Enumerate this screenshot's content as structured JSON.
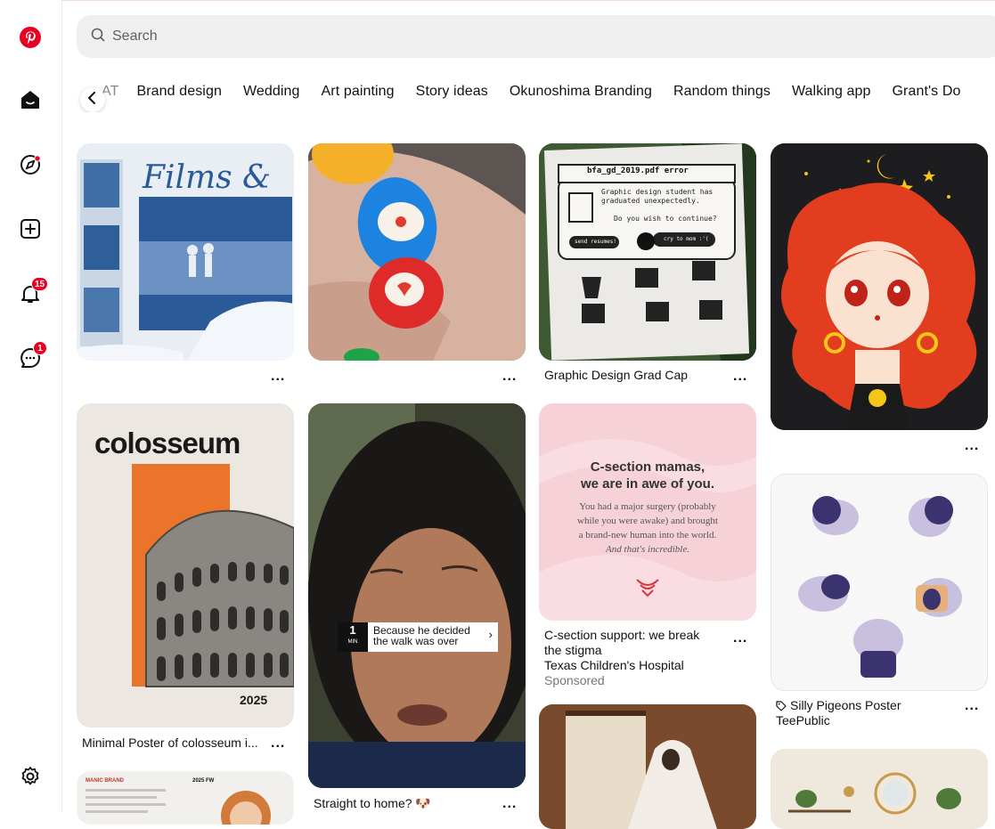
{
  "search": {
    "placeholder": "Search"
  },
  "chips": [
    "AT",
    "Brand design",
    "Wedding",
    "Art painting",
    "Story ideas",
    "Okunoshima Branding",
    "Random things",
    "Walking app",
    "Grant's Do"
  ],
  "badges": {
    "notifications": "15",
    "messages": "1"
  },
  "more_label": "...",
  "pins": {
    "films": {
      "title_art": "Films & tv"
    },
    "nails": {},
    "gradcap": {
      "caption": "Graphic Design Grad Cap",
      "art_title": "bfa_gd_2019.pdf error",
      "art_msg1": "Graphic design student has graduated unexpectedly.",
      "art_msg2": "Do you wish to continue?",
      "art_btn1": "send resumes!",
      "art_btn2": "cry to mom :'("
    },
    "anime": {},
    "colosseum": {
      "caption": "Minimal Poster of colosseum i...",
      "art_word": "colosseum",
      "art_year": "2025"
    },
    "video": {
      "caption": "Straight to home? 🐶",
      "overlay_num": "1",
      "overlay_unit": "MIN",
      "overlay_line1": "Because he decided",
      "overlay_line2": "the walk was over"
    },
    "csection": {
      "caption_line1": "C-section support: we break",
      "caption_line2": "the stigma",
      "advertiser": "Texas Children's Hospital",
      "sponsored": "Sponsored",
      "art_head1": "C-section mamas,",
      "art_head2": "we are in awe of you.",
      "art_body1": "You had a major surgery (probably",
      "art_body2": "while you were awake) and brought",
      "art_body3": "a brand-new human into the world.",
      "art_body4": "And that's incredible."
    },
    "pigeons": {
      "caption": "Silly Pigeons Poster",
      "shop": "TeePublic"
    },
    "wedding": {},
    "fashion": {
      "art_left": "MANIC BRAND",
      "art_right": "2025 FW"
    },
    "mirrors": {}
  },
  "colors": {
    "brand": "#e60023"
  }
}
